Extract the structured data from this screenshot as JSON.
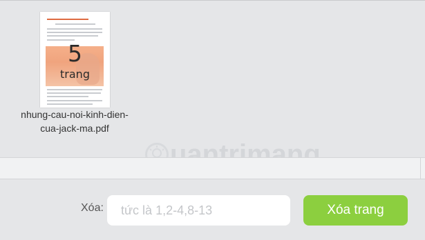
{
  "file": {
    "name": "nhung-cau-noi-kinh-dien-cua-jack-ma.pdf",
    "name_line1": "nhung-cau-noi-kinh-dien-",
    "name_line2": "cua-jack-ma.pdf",
    "page_count": "5",
    "page_unit": "trang"
  },
  "watermark": {
    "text": "uantrimang",
    "icon": "lightbulb-icon"
  },
  "controls": {
    "delete_label": "Xóa:",
    "pages_input_value": "",
    "pages_input_placeholder": "tức là 1,2-4,8-13",
    "delete_button_label": "Xóa trang"
  },
  "colors": {
    "background": "#e5e6e8",
    "button": "#8ccf3f",
    "input_bg": "#ffffff"
  }
}
